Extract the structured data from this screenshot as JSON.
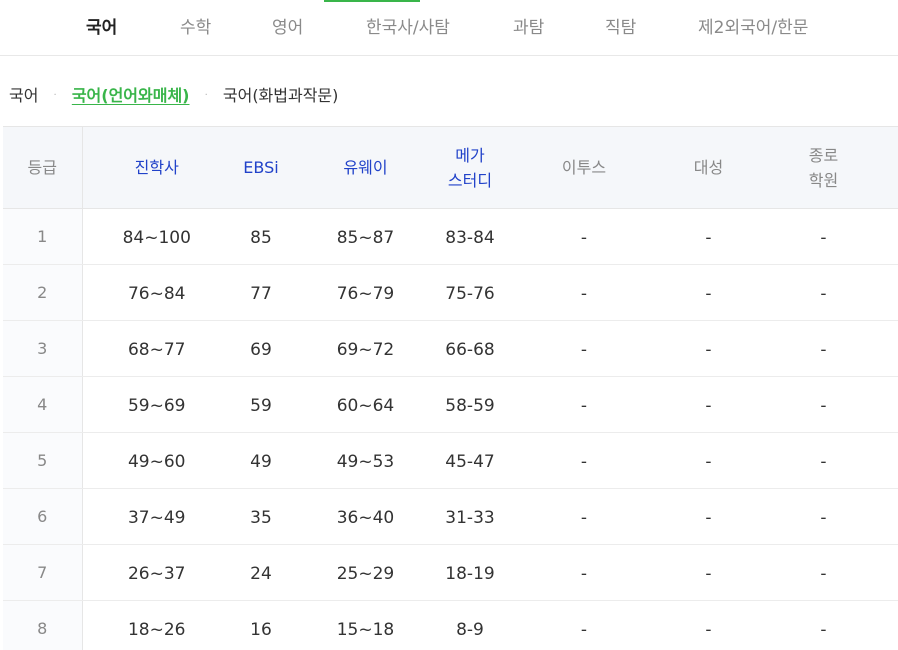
{
  "tabs": [
    {
      "label": "국어",
      "active": true
    },
    {
      "label": "수학",
      "active": false
    },
    {
      "label": "영어",
      "active": false
    },
    {
      "label": "한국사/사탐",
      "active": false
    },
    {
      "label": "과탐",
      "active": false
    },
    {
      "label": "직탐",
      "active": false
    },
    {
      "label": "제2외국어/한문",
      "active": false
    }
  ],
  "subnav": {
    "items": [
      "국어",
      "국어(언어와매체)",
      "국어(화법과작문)"
    ],
    "active_index": 1,
    "separator": "·"
  },
  "table": {
    "headers": {
      "grade": "등급",
      "jinhak": "진학사",
      "ebsi": "EBSi",
      "uway_line1": "유웨이",
      "mega_line1": "메가",
      "mega_line2": "스터디",
      "etoos": "이투스",
      "daesung": "대성",
      "jongro_line1": "종로",
      "jongro_line2": "학원"
    },
    "rows": [
      {
        "grade": "1",
        "jinhak": "84~100",
        "ebsi": "85",
        "uway": "85~87",
        "mega": "83-84",
        "etoos": "-",
        "daesung": "-",
        "jongro": "-"
      },
      {
        "grade": "2",
        "jinhak": "76~84",
        "ebsi": "77",
        "uway": "76~79",
        "mega": "75-76",
        "etoos": "-",
        "daesung": "-",
        "jongro": "-"
      },
      {
        "grade": "3",
        "jinhak": "68~77",
        "ebsi": "69",
        "uway": "69~72",
        "mega": "66-68",
        "etoos": "-",
        "daesung": "-",
        "jongro": "-"
      },
      {
        "grade": "4",
        "jinhak": "59~69",
        "ebsi": "59",
        "uway": "60~64",
        "mega": "58-59",
        "etoos": "-",
        "daesung": "-",
        "jongro": "-"
      },
      {
        "grade": "5",
        "jinhak": "49~60",
        "ebsi": "49",
        "uway": "49~53",
        "mega": "45-47",
        "etoos": "-",
        "daesung": "-",
        "jongro": "-"
      },
      {
        "grade": "6",
        "jinhak": "37~49",
        "ebsi": "35",
        "uway": "36~40",
        "mega": "31-33",
        "etoos": "-",
        "daesung": "-",
        "jongro": "-"
      },
      {
        "grade": "7",
        "jinhak": "26~37",
        "ebsi": "24",
        "uway": "25~29",
        "mega": "18-19",
        "etoos": "-",
        "daesung": "-",
        "jongro": "-"
      },
      {
        "grade": "8",
        "jinhak": "18~26",
        "ebsi": "16",
        "uway": "15~18",
        "mega": "8-9",
        "etoos": "-",
        "daesung": "-",
        "jongro": "-"
      }
    ]
  },
  "colors": {
    "accent": "#39b54a",
    "header_source": "#2142c9"
  }
}
